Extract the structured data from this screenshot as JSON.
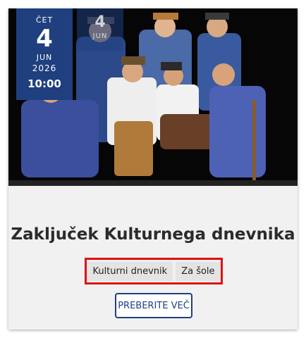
{
  "event": {
    "date": {
      "day_of_week": "ČET",
      "day": "4",
      "month": "JUN",
      "year": "2026",
      "time": "10:00"
    },
    "ghost_date": {
      "day": "4",
      "month": "JUN"
    },
    "title": "Zaključek Kulturnega dnevnika",
    "tags": [
      "Kulturni dnevnik",
      "Za šole"
    ],
    "read_more_label": "PREBERITE VEČ"
  },
  "colors": {
    "accent": "#1f3f7f",
    "highlight_border": "#e01010",
    "card_bg": "#f1f1f1",
    "tag_bg": "#e4e4e4"
  }
}
